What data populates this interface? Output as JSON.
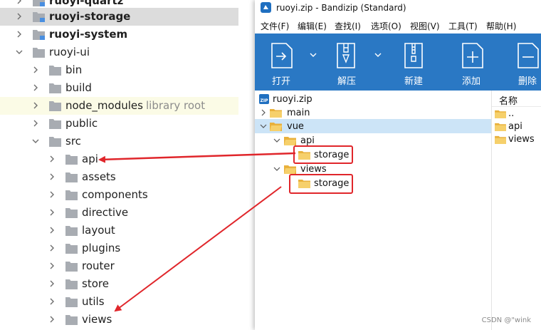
{
  "ide_tree": {
    "rows": [
      {
        "label": "ruoyi-quartz",
        "bold": true
      },
      {
        "label": "ruoyi-storage",
        "bold": true
      },
      {
        "label": "ruoyi-system",
        "bold": true
      },
      {
        "label": "ruoyi-ui",
        "bold": false
      },
      {
        "label": "bin"
      },
      {
        "label": "build"
      },
      {
        "label": "node_modules",
        "sublabel": "library root"
      },
      {
        "label": "public"
      },
      {
        "label": "src"
      },
      {
        "label": "api"
      },
      {
        "label": "assets"
      },
      {
        "label": "components"
      },
      {
        "label": "directive"
      },
      {
        "label": "layout"
      },
      {
        "label": "plugins"
      },
      {
        "label": "router"
      },
      {
        "label": "store"
      },
      {
        "label": "utils"
      },
      {
        "label": "views"
      }
    ]
  },
  "bandizip": {
    "title": "ruoyi.zip - Bandizip (Standard)",
    "menu": [
      "文件(F)",
      "编辑(E)",
      "查找(I)",
      "选项(O)",
      "视图(V)",
      "工具(T)",
      "帮助(H)"
    ],
    "toolbar": {
      "open": "打开",
      "extract": "解压",
      "new": "新建",
      "add": "添加",
      "delete": "删除"
    },
    "tree": {
      "root": "ruoyi.zip",
      "main": "main",
      "vue": "vue",
      "api": "api",
      "api_storage": "storage",
      "views": "views",
      "views_storage": "storage"
    },
    "list": {
      "header": "名称",
      "items": [
        "..",
        "api",
        "views"
      ]
    }
  },
  "watermark": "CSDN @\"wink",
  "colors": {
    "toolbar_blue": "#2a78c4",
    "folder_grey": "#a8acb2",
    "folder_yellow": "#f3c65a",
    "highlight_red": "#e0262b",
    "selection_blue": "#cce4f7"
  }
}
